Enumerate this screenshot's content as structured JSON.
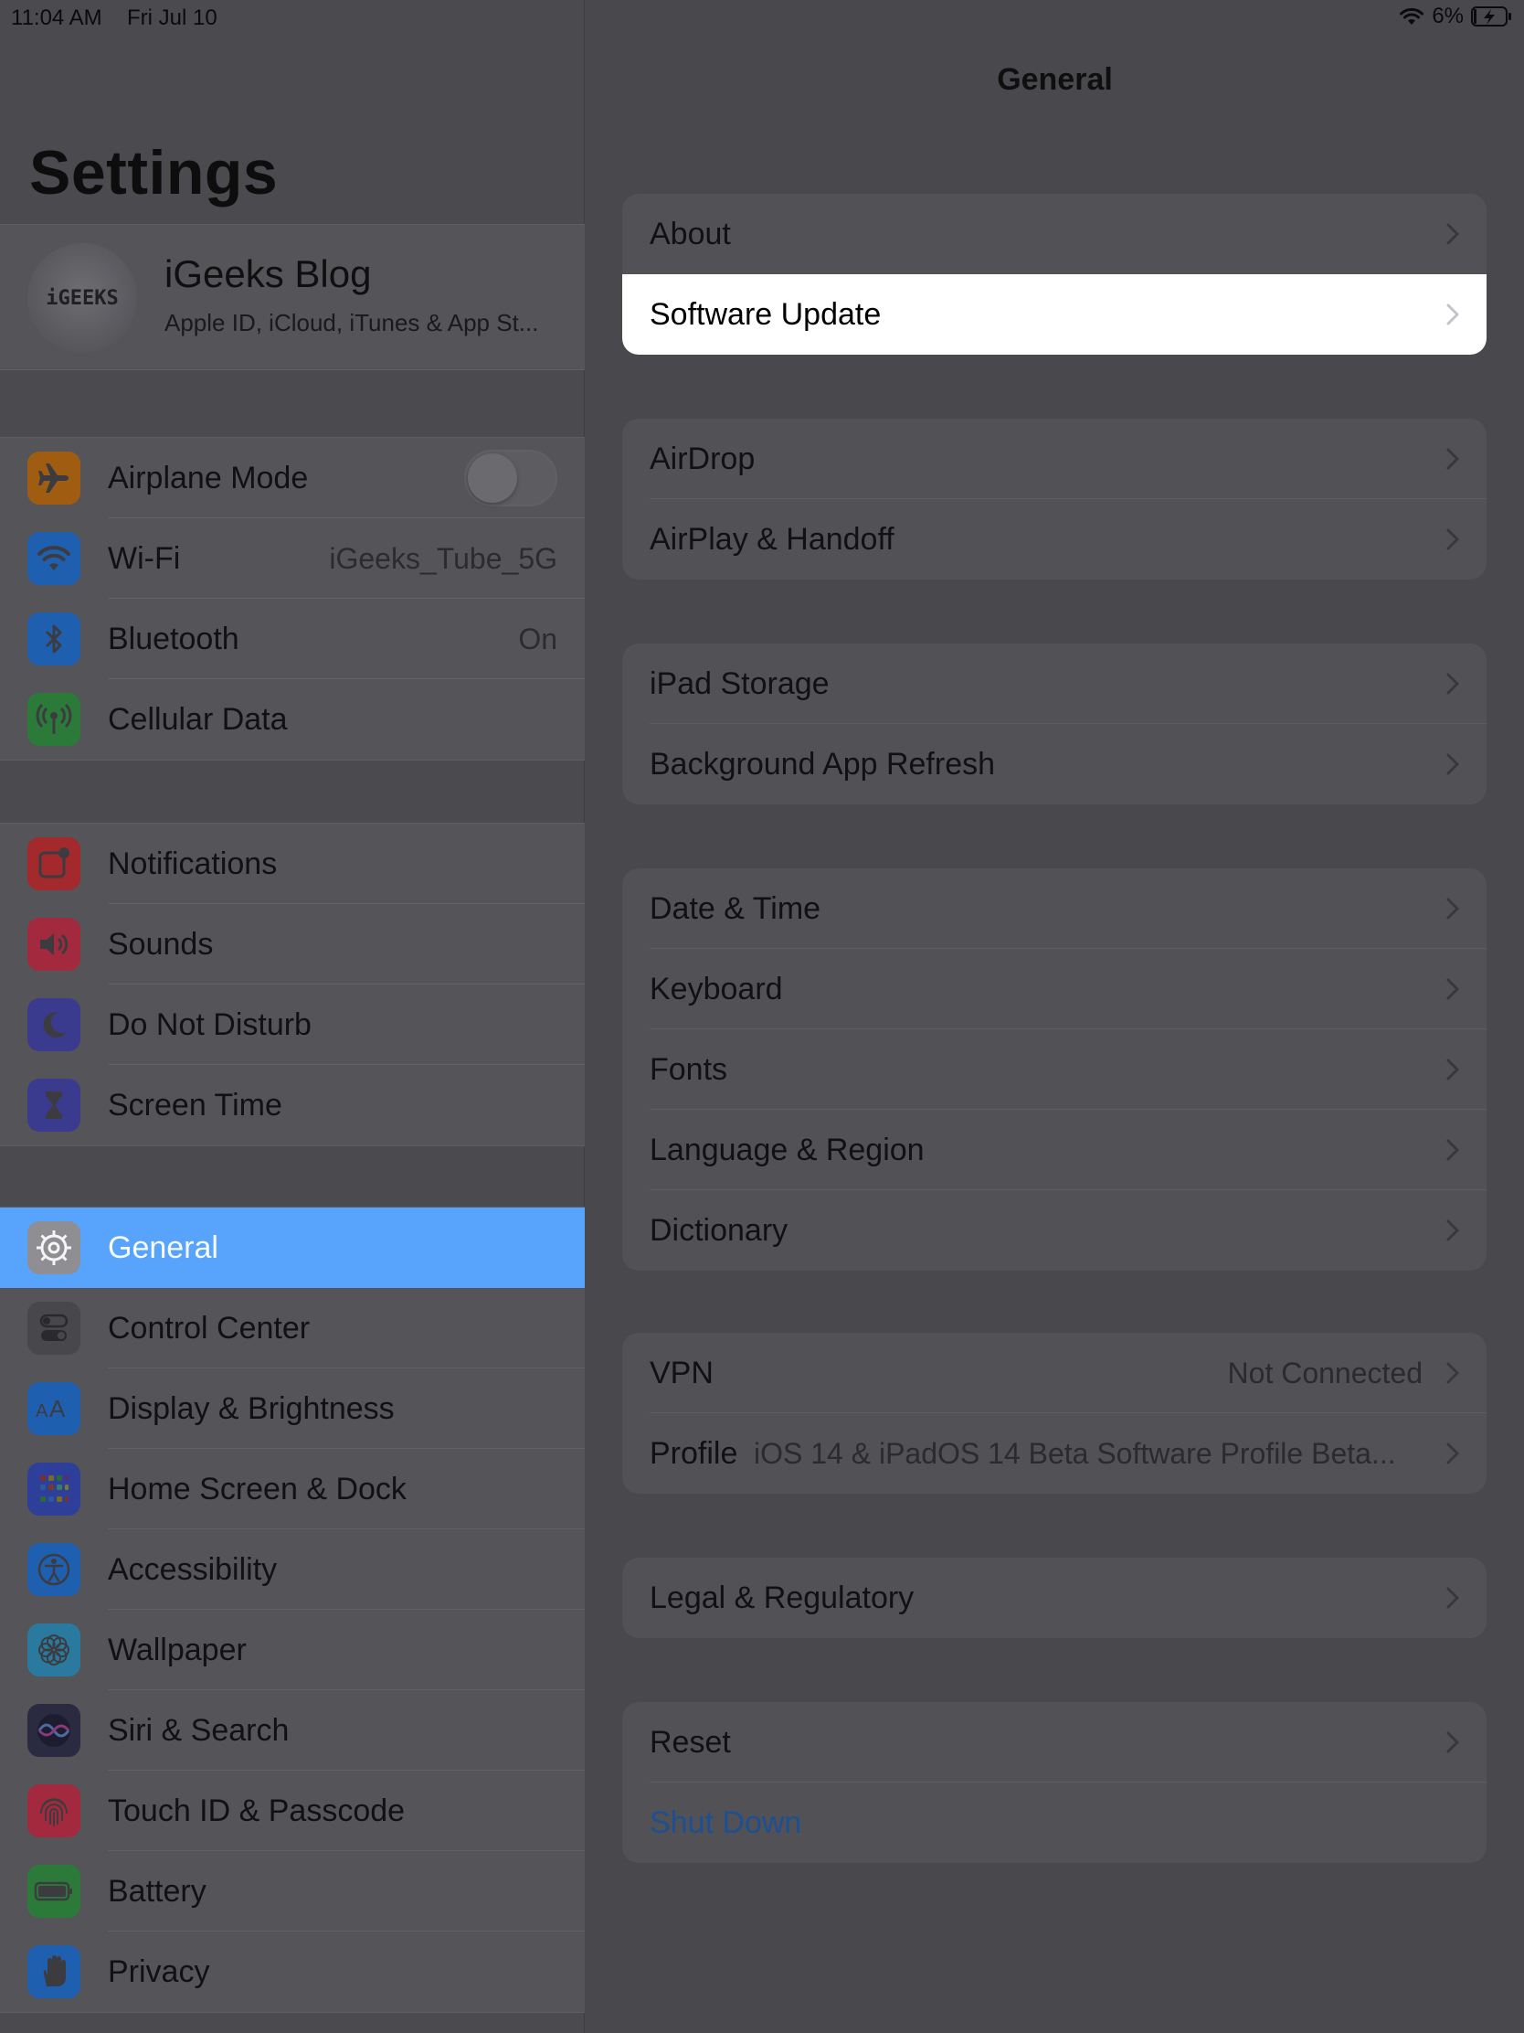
{
  "status": {
    "time": "11:04 AM",
    "date": "Fri Jul 10",
    "battery_percent": "6%",
    "icons": [
      "wifi-icon",
      "battery-charging-icon"
    ]
  },
  "sidebar": {
    "title": "Settings",
    "profile": {
      "avatar_text": "iGEEKS",
      "name": "iGeeks Blog",
      "subtitle": "Apple ID, iCloud, iTunes & App St..."
    },
    "groups": [
      {
        "items": [
          {
            "label": "Airplane Mode",
            "icon": "airplane-icon",
            "color": "#a05d12",
            "toggle": false
          },
          {
            "label": "Wi-Fi",
            "icon": "wifi-icon",
            "color": "#1f5fb0",
            "value": "iGeeks_Tube_5G"
          },
          {
            "label": "Bluetooth",
            "icon": "bluetooth-icon",
            "color": "#1f5fb0",
            "value": "On"
          },
          {
            "label": "Cellular Data",
            "icon": "antenna-icon",
            "color": "#2b7a3a"
          }
        ]
      },
      {
        "items": [
          {
            "label": "Notifications",
            "icon": "notifications-icon",
            "color": "#a3292c"
          },
          {
            "label": "Sounds",
            "icon": "speaker-icon",
            "color": "#a3293f"
          },
          {
            "label": "Do Not Disturb",
            "icon": "moon-icon",
            "color": "#3a3a8e"
          },
          {
            "label": "Screen Time",
            "icon": "hourglass-icon",
            "color": "#3a3a8e"
          }
        ]
      },
      {
        "items": [
          {
            "label": "General",
            "icon": "gear-icon",
            "color": "#8e8e93",
            "selected": true
          },
          {
            "label": "Control Center",
            "icon": "switches-icon",
            "color": "#48484c"
          },
          {
            "label": "Display & Brightness",
            "icon": "text-size-icon",
            "color": "#1f5fb0"
          },
          {
            "label": "Home Screen & Dock",
            "icon": "grid-icon",
            "color": "#2e3f9a"
          },
          {
            "label": "Accessibility",
            "icon": "accessibility-icon",
            "color": "#1f5fb0"
          },
          {
            "label": "Wallpaper",
            "icon": "flower-icon",
            "color": "#2a7aa0"
          },
          {
            "label": "Siri & Search",
            "icon": "siri-icon",
            "color": "#2a2a40"
          },
          {
            "label": "Touch ID & Passcode",
            "icon": "fingerprint-icon",
            "color": "#a3293f"
          },
          {
            "label": "Battery",
            "icon": "battery-icon",
            "color": "#2b7a3a"
          },
          {
            "label": "Privacy",
            "icon": "hand-icon",
            "color": "#1f5fb0"
          }
        ]
      }
    ]
  },
  "detail": {
    "title": "General",
    "groups": [
      {
        "rows": [
          {
            "label": "About"
          },
          {
            "label": "Software Update",
            "highlight": true
          }
        ]
      },
      {
        "rows": [
          {
            "label": "AirDrop"
          },
          {
            "label": "AirPlay & Handoff"
          }
        ]
      },
      {
        "rows": [
          {
            "label": "iPad Storage"
          },
          {
            "label": "Background App Refresh"
          }
        ]
      },
      {
        "rows": [
          {
            "label": "Date & Time"
          },
          {
            "label": "Keyboard"
          },
          {
            "label": "Fonts"
          },
          {
            "label": "Language & Region"
          },
          {
            "label": "Dictionary"
          }
        ]
      },
      {
        "rows": [
          {
            "label": "VPN",
            "value": "Not Connected"
          },
          {
            "label": "Profile",
            "value": "iOS 14 & iPadOS 14 Beta Software Profile Beta..."
          }
        ]
      },
      {
        "rows": [
          {
            "label": "Legal & Regulatory"
          }
        ]
      },
      {
        "rows": [
          {
            "label": "Reset"
          },
          {
            "label": "Shut Down",
            "link": true,
            "no_chevron": true
          }
        ]
      }
    ]
  }
}
